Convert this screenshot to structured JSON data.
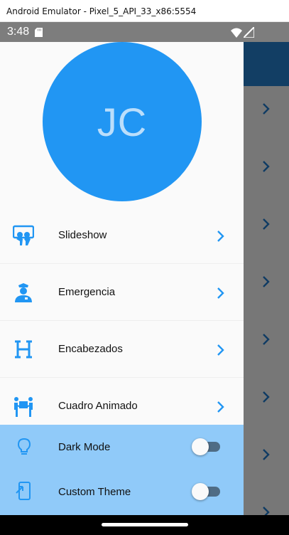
{
  "window": {
    "title": "Android Emulator - Pixel_5_API_33_x86:5554"
  },
  "statusbar": {
    "time": "3:48",
    "icons": [
      "sd-card-icon",
      "wifi-icon",
      "signal-icon"
    ]
  },
  "drawer": {
    "avatar_initials": "JC",
    "avatar_color": "#2196f3",
    "menu": [
      {
        "label": "Slideshow",
        "icon": "slideshow-icon"
      },
      {
        "label": "Emergencia",
        "icon": "police-officer-icon"
      },
      {
        "label": "Encabezados",
        "icon": "heading-h-icon"
      },
      {
        "label": "Cuadro Animado",
        "icon": "people-carry-box-icon"
      }
    ],
    "settings": [
      {
        "label": "Dark Mode",
        "icon": "lightbulb-icon",
        "enabled": false
      },
      {
        "label": "Custom Theme",
        "icon": "phone-mobile-icon",
        "enabled": false
      }
    ]
  },
  "colors": {
    "accent": "#2196f3",
    "settings_bg": "#90caf9",
    "appbar": "#123e64"
  }
}
